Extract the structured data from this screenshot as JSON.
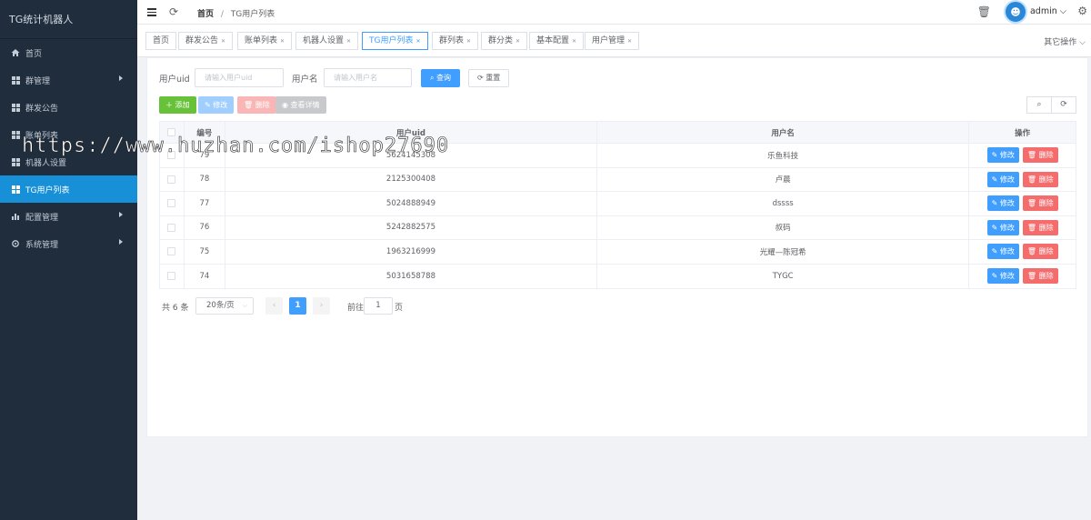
{
  "app": {
    "title": "TG统计机器人"
  },
  "sidebar": {
    "items": [
      {
        "label": "首页",
        "icon": "home-icon",
        "has_children": false,
        "active": false
      },
      {
        "label": "群管理",
        "icon": "grid-icon",
        "has_children": true,
        "active": false
      },
      {
        "label": "群发公告",
        "icon": "grid-icon",
        "has_children": false,
        "active": false
      },
      {
        "label": "账单列表",
        "icon": "grid-icon",
        "has_children": false,
        "active": false
      },
      {
        "label": "机器人设置",
        "icon": "grid-icon",
        "has_children": false,
        "active": false
      },
      {
        "label": "TG用户列表",
        "icon": "grid-icon",
        "has_children": false,
        "active": true
      },
      {
        "label": "配置管理",
        "icon": "bar-chart-icon",
        "has_children": true,
        "active": false
      },
      {
        "label": "系统管理",
        "icon": "gear-icon",
        "has_children": true,
        "active": false
      }
    ]
  },
  "header": {
    "breadcrumb_home": "首页",
    "breadcrumb_sep": "/",
    "breadcrumb_current": "TG用户列表",
    "user": "admin"
  },
  "tags": {
    "items": [
      "首页",
      "群发公告",
      "账单列表",
      "机器人设置",
      "TG用户列表",
      "群列表",
      "群分类",
      "基本配置",
      "用户管理"
    ],
    "more": "其它操作"
  },
  "search": {
    "uid_label": "用户uid",
    "uid_placeholder": "请输入用户uid",
    "name_label": "用户名",
    "name_placeholder": "请输入用户名",
    "query_btn": "查询",
    "reset_btn": "重置"
  },
  "toolbar": {
    "add": "添加",
    "edit": "修改",
    "delete": "删除",
    "detail": "查看详情"
  },
  "table": {
    "headers": {
      "id": "编号",
      "uid": "用户uid",
      "name": "用户名",
      "ops": "操作"
    },
    "rows": [
      {
        "id": "79",
        "uid": "5624145308",
        "name": "乐鱼科技"
      },
      {
        "id": "78",
        "uid": "2125300408",
        "name": "卢晨"
      },
      {
        "id": "77",
        "uid": "5024888949",
        "name": "dssss"
      },
      {
        "id": "76",
        "uid": "5242882575",
        "name": "叔码"
      },
      {
        "id": "75",
        "uid": "1963216999",
        "name": "光耀—陈冠希"
      },
      {
        "id": "74",
        "uid": "5031658788",
        "name": "TYGC"
      }
    ],
    "row_edit": "修改",
    "row_delete": "删除"
  },
  "pagination": {
    "total": "共 6 条",
    "page_size": "20条/页",
    "current": "1",
    "goto_label": "前往",
    "goto_value": "1",
    "page_label": "页"
  },
  "watermark": "https://www.huzhan.com/ishop27690"
}
